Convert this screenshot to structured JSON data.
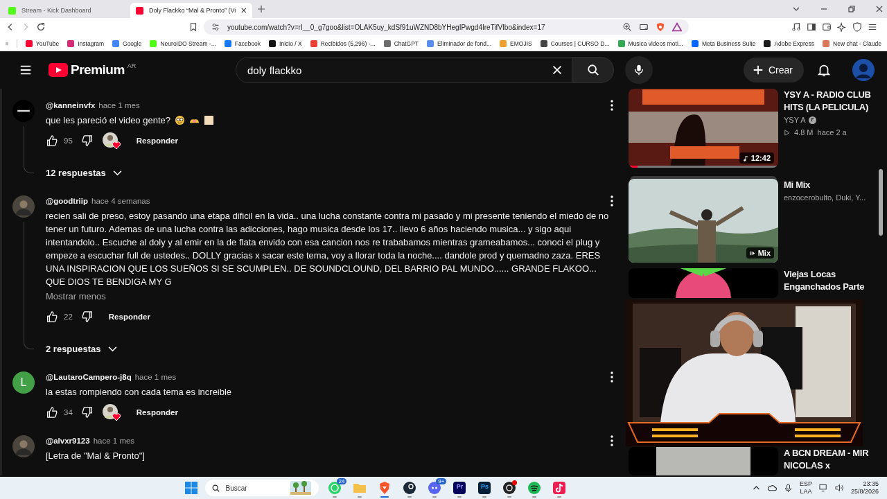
{
  "browser": {
    "tabs": [
      {
        "title": "Stream - Kick Dashboard",
        "selected": false,
        "color": "#53fc18"
      },
      {
        "title": "Doly Flackko “Mal & Pronto” (Vi",
        "selected": true,
        "color": "#ff0033"
      }
    ],
    "url": "youtube.com/watch?v=rI__0_g7goo&list=OLAK5uy_kdSf91uWZND8bYHegIPwgd4IreTifVIbo&index=17",
    "bookmarks": [
      {
        "label": "YouTube",
        "color": "#ff0033"
      },
      {
        "label": "Instagram",
        "color": "#d62976"
      },
      {
        "label": "Google",
        "color": "#4285f4"
      },
      {
        "label": "NeuroIDO Stream -...",
        "color": "#53fc18"
      },
      {
        "label": "Facebook",
        "color": "#1877f2"
      },
      {
        "label": "Inicio / X",
        "color": "#111111"
      },
      {
        "label": "Recibidos (5,296) -...",
        "color": "#ea4335"
      },
      {
        "label": "ChatGPT",
        "color": "#6b6b6b"
      },
      {
        "label": "Eliminador de fond...",
        "color": "#5b8def"
      },
      {
        "label": "EMOJIS",
        "color": "#f0a030"
      },
      {
        "label": "Courses | CURSO D...",
        "color": "#444444"
      },
      {
        "label": "Musica videos moti...",
        "color": "#34a853"
      },
      {
        "label": "Meta Business Suite",
        "color": "#0866ff"
      },
      {
        "label": "Adobe Express",
        "color": "#1a1a1a"
      },
      {
        "label": "New chat - Claude",
        "color": "#d97757"
      }
    ]
  },
  "youtube": {
    "logo_label": "Premium",
    "region": "AR",
    "search": {
      "value": "doly flackko"
    },
    "create_label": "Crear"
  },
  "comments": [
    {
      "avatar": {
        "kind": "logo"
      },
      "author": "@kanneinvfx",
      "time": "hace 1 mes",
      "text": "que les pareció el video gente?",
      "emojis": [
        {
          "kind": "nerd-face"
        },
        {
          "kind": "heart-hands"
        },
        {
          "kind": "blank-square"
        }
      ],
      "likes": "95",
      "creator_heart": true,
      "reply_label": "Responder",
      "replies": "12 respuestas"
    },
    {
      "author": "@goodtriip",
      "time": "hace 4 semanas",
      "text": "recien sali de preso, estoy pasando una etapa dificil en la vida.. una lucha constante contra mi pasado y mi presente teniendo el miedo de no tener un futuro. Ademas de una lucha contra las adicciones, hago musica desde los 17.. llevo 6 años haciendo musica... y sigo aqui intentandolo.. Escuche al doly y al emir en la de flata envido con esa cancion nos re trababamos mientras grameabamos... conoci el plug y empeze a escuchar full de ustedes.. DOLLY gracias x sacar este tema, voy a llorar toda la noche.... dandole prod y quemadno zaza. ERES UNA INSPIRACION QUE LOS SUEÑOS SI SE SCUMPLEN.. DE SOUNDCLOUND, DEL BARRIO PAL MUNDO...... GRANDE FLAKOO... QUE DIOS TE BENDIGA MY G",
      "show_less": "Mostrar menos",
      "likes": "22",
      "creator_heart": false,
      "reply_label": "Responder",
      "replies": "2 respuestas"
    },
    {
      "avatar": {
        "kind": "letter",
        "letter": "L"
      },
      "author": "@LautaroCampero-j8q",
      "time": "hace 1 mes",
      "text": "la estas rompiendo con cada tema es increible",
      "likes": "34",
      "creator_heart": true,
      "reply_label": "Responder"
    },
    {
      "author": "@alvxr9123",
      "time": "hace 1 mes",
      "text": "[Letra de \"Mal & Pronto\"]"
    }
  ],
  "sidebar": {
    "videos": [
      {
        "title": "YSY A - RADIO CLUB HITS (LA PELICULA)",
        "channel": "YSY A",
        "verified": true,
        "views": "4.8 M",
        "age": "hace 2 a",
        "badge": {
          "kind": "duration",
          "text": "12:42"
        },
        "level": 0.06
      },
      {
        "title": "Mi Mix",
        "channel": "enzocerobulto, Duki, Y...",
        "badge": {
          "kind": "mix",
          "text": "Mix"
        }
      },
      {
        "title": "Viejas Locas Enganchados Parte"
      },
      {
        "title": "A BCN DREAM - MIR NICOLAS x"
      }
    ]
  },
  "taskbar": {
    "search_placeholder": "Buscar",
    "apps": [
      {
        "kind": "whatsapp",
        "badge": "24",
        "selected": false
      },
      {
        "kind": "folder",
        "selected": false
      },
      {
        "kind": "brave",
        "selected": true
      },
      {
        "kind": "steam",
        "selected": false
      },
      {
        "kind": "discord",
        "badge": "9+",
        "selected": false
      },
      {
        "kind": "premiere",
        "label": "Pr",
        "selected": false
      },
      {
        "kind": "photoshop",
        "label": "Ps",
        "selected": false
      },
      {
        "kind": "obs",
        "selected": false
      },
      {
        "kind": "spotify",
        "selected": false
      },
      {
        "kind": "tiktok",
        "selected": false
      }
    ],
    "language": "ESP",
    "layout": "LAA",
    "time": "23:35",
    "date": "25/8/2026"
  }
}
